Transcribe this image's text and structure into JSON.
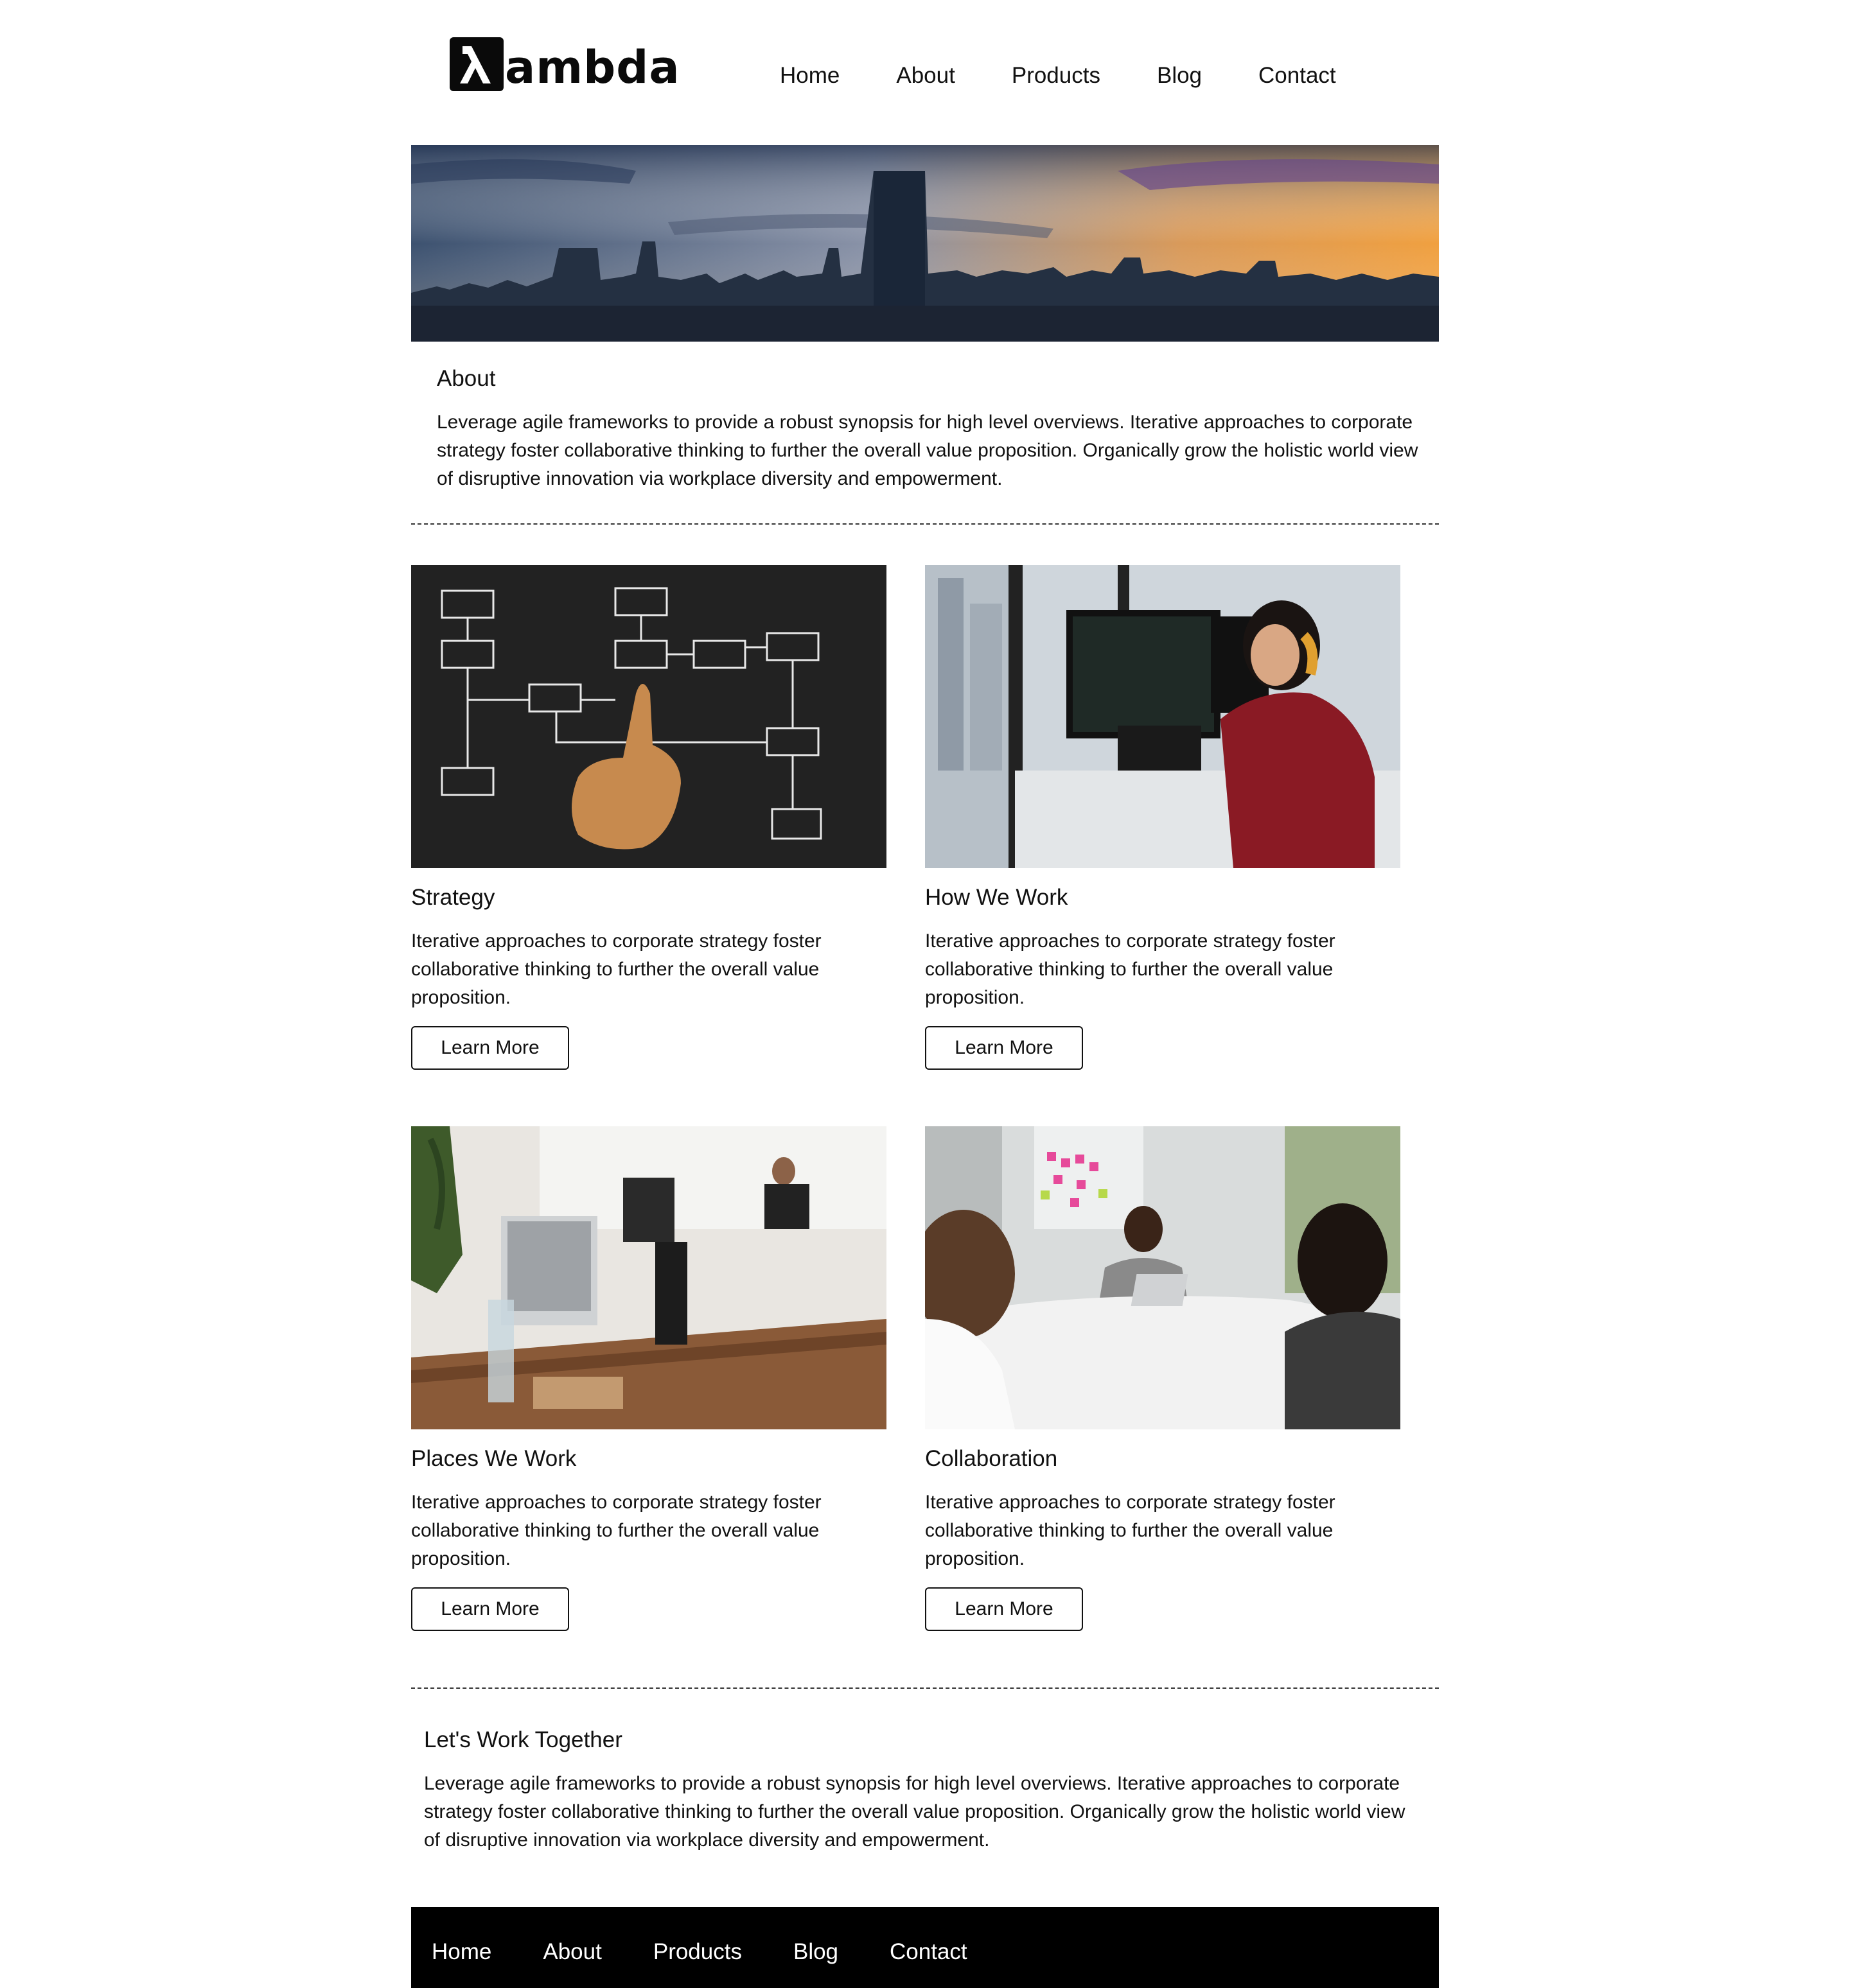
{
  "brand": {
    "logo_text": "ambda",
    "logo_symbol": "λ"
  },
  "nav": {
    "items": [
      "Home",
      "About",
      "Products",
      "Blog",
      "Contact"
    ]
  },
  "hero": {
    "image": "city-skyline-sunset"
  },
  "about": {
    "title": "About",
    "body": "Leverage agile frameworks to provide a robust synopsis for high level overviews. Iterative approaches to corporate strategy foster collaborative thinking to further the overall value proposition. Organically grow the holistic world view of disruptive innovation via workplace diversity and empowerment."
  },
  "cards": [
    {
      "title": "Strategy",
      "body": "Iterative approaches to corporate strategy foster collaborative thinking to further the overall value proposition.",
      "button": "Learn More",
      "image": "chalkboard-flowchart"
    },
    {
      "title": "How We Work",
      "body": "Iterative approaches to corporate strategy foster collaborative thinking to further the overall value proposition.",
      "button": "Learn More",
      "image": "developer-at-monitors"
    },
    {
      "title": "Places We Work",
      "body": "Iterative approaches to corporate strategy foster collaborative thinking to further the overall value proposition.",
      "button": "Learn More",
      "image": "office-desks"
    },
    {
      "title": "Collaboration",
      "body": "Iterative approaches to corporate strategy foster collaborative thinking to further the overall value proposition.",
      "button": "Learn More",
      "image": "team-meeting"
    }
  ],
  "together": {
    "title": "Let's Work Together",
    "body": "Leverage agile frameworks to provide a robust synopsis for high level overviews. Iterative approaches to corporate strategy foster collaborative thinking to further the overall value proposition. Organically grow the holistic world view of disruptive innovation via workplace diversity and empowerment."
  },
  "footer": {
    "nav": [
      "Home",
      "About",
      "Products",
      "Blog",
      "Contact"
    ]
  },
  "colors": {
    "text": "#111111",
    "footer_bg": "#000000",
    "footer_text": "#ffffff"
  }
}
